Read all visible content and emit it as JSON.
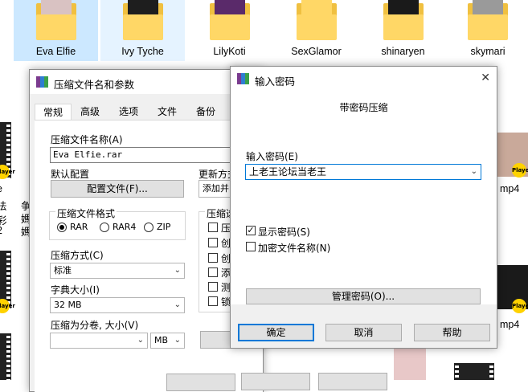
{
  "explorer": {
    "folders": [
      {
        "name": "Eva Elfie",
        "state": "selected"
      },
      {
        "name": "Ivy Tyche",
        "state": "hover"
      },
      {
        "name": "LilyKoti",
        "state": "normal"
      },
      {
        "name": "SexGlamor",
        "state": "normal"
      },
      {
        "name": "shinaryen",
        "state": "normal"
      },
      {
        "name": "skymari",
        "state": "normal"
      }
    ],
    "left_fragments": [
      "е",
      "法",
      "彩",
      "2",
      "争",
      "媽",
      "媽"
    ],
    "right_labels": [
      "mp4",
      "mp4"
    ],
    "player_badge": "Player"
  },
  "archive_dialog": {
    "title": "压缩文件名和参数",
    "tabs": [
      "常规",
      "高级",
      "选项",
      "文件",
      "备份"
    ],
    "filename_label": "压缩文件名称(A)",
    "filename_value": "Eva Elfie.rar",
    "default_config_label": "默认配置",
    "config_button": "配置文件(F)...",
    "update_mode_label": "更新方式",
    "update_mode_value": "添加并",
    "format_label": "压缩文件格式",
    "formats": [
      "RAR",
      "RAR4",
      "ZIP"
    ],
    "selected_format": "RAR",
    "options_label": "压缩选",
    "options": [
      "压",
      "创",
      "创",
      "添",
      "测",
      "锁"
    ],
    "method_label": "压缩方式(C)",
    "method_value": "标准",
    "dict_label": "字典大小(I)",
    "dict_value": "32 MB",
    "split_label": "压缩为分卷, 大小(V)",
    "split_unit": "MB"
  },
  "password_dialog": {
    "title": "输入密码",
    "heading": "带密码压缩",
    "password_label": "输入密码(E)",
    "password_value": "上老王论坛当老王",
    "show_password": "显示密码(S)",
    "show_password_checked": true,
    "encrypt_names": "加密文件名称(N)",
    "encrypt_names_checked": false,
    "manage_button": "管理密码(O)...",
    "ok_button": "确定",
    "cancel_button": "取消",
    "help_button": "帮助",
    "close_glyph": "✕"
  }
}
